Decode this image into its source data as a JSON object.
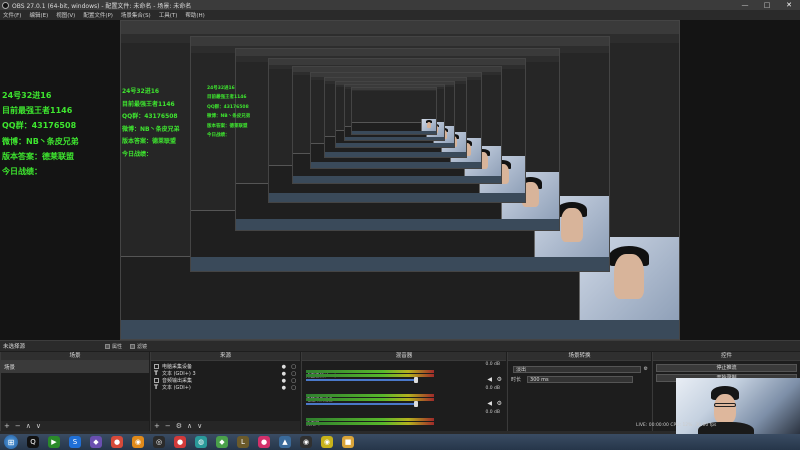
{
  "window": {
    "title": "OBS 27.0.1 (64-bit, windows) - 配置文件: 未命名 - 场景: 未命名",
    "controls": {
      "minimize": "—",
      "maximize": "□",
      "close": "✕"
    }
  },
  "menu": [
    "文件(F)",
    "编辑(E)",
    "视图(V)",
    "配置文件(P)",
    "场景集合(S)",
    "工具(T)",
    "帮助(H)"
  ],
  "overlay": {
    "lines": [
      "24号32进16",
      "目前最强王者1146",
      "QQ群：43176508",
      "微博：NB丶条皮兄弟",
      "版本答案：德莱联盟",
      "今日战绩："
    ]
  },
  "panels_bar": {
    "title": "未选择源",
    "properties": "属性",
    "filters": "滤镜"
  },
  "scenes": {
    "header": "场景",
    "items": [
      "场景"
    ],
    "footer": [
      "+",
      "−",
      "∧",
      "∨"
    ]
  },
  "sources": {
    "header": "来源",
    "items": [
      {
        "name": "电脑采集设备",
        "icon": "display-capture-icon"
      },
      {
        "name": "文本 (GDI+) 3",
        "icon": "text-icon"
      },
      {
        "name": "音频输出采集",
        "icon": "audio-icon"
      },
      {
        "name": "文本 (GDI+)",
        "icon": "text-icon"
      }
    ],
    "footer": [
      "+",
      "−",
      "⚙",
      "∧",
      "∨"
    ]
  },
  "mixer": {
    "header": "混音器",
    "channels": [
      {
        "name": "桌面音频(Aux)",
        "db": "0.0 dB"
      },
      {
        "name": "电脑采集设备",
        "db": "0.0 dB"
      },
      {
        "name": "麦克风",
        "db": "0.0 dB"
      }
    ]
  },
  "transitions": {
    "header": "场景转换",
    "type_label": "淡出",
    "duration_label": "时长",
    "duration_value": "300 ms"
  },
  "controls": {
    "header": "控件",
    "buttons": [
      "停止推流",
      "开始录制"
    ]
  },
  "status": {
    "text": "LIVE: 00:00:00  CPU: 12%, 30.00 fps"
  },
  "taskbar": {
    "start": "⊞",
    "apps": [
      {
        "name": "qq-app-icon",
        "glyph": "Q",
        "color": "#111111"
      },
      {
        "name": "video-app-icon",
        "glyph": "▶",
        "color": "#2a8a2a"
      },
      {
        "name": "s-app-icon",
        "glyph": "S",
        "color": "#1f6fd6"
      },
      {
        "name": "wizard-app-icon",
        "glyph": "◆",
        "color": "#6a4fb0"
      },
      {
        "name": "chrome-app-icon",
        "glyph": "●",
        "color": "#d64a3a"
      },
      {
        "name": "orange-app-icon",
        "glyph": "◉",
        "color": "#e08a1a"
      },
      {
        "name": "camera-app-icon",
        "glyph": "◎",
        "color": "#2b2b2b"
      },
      {
        "name": "red-app-icon",
        "glyph": "●",
        "color": "#d23a3a"
      },
      {
        "name": "teal-app-icon",
        "glyph": "◍",
        "color": "#2a9a9a"
      },
      {
        "name": "green-app-icon",
        "glyph": "◆",
        "color": "#4aa04a"
      },
      {
        "name": "league-app-icon",
        "glyph": "L",
        "color": "#6b5a2a"
      },
      {
        "name": "pink-app-icon",
        "glyph": "●",
        "color": "#d2306a"
      },
      {
        "name": "photo-app-icon",
        "glyph": "▲",
        "color": "#3a6a9a"
      },
      {
        "name": "obs-app-icon",
        "glyph": "◉",
        "color": "#303030"
      },
      {
        "name": "yellow-app-icon",
        "glyph": "◉",
        "color": "#c8b21a"
      },
      {
        "name": "folder-app-icon",
        "glyph": "■",
        "color": "#d9a43a"
      }
    ]
  }
}
